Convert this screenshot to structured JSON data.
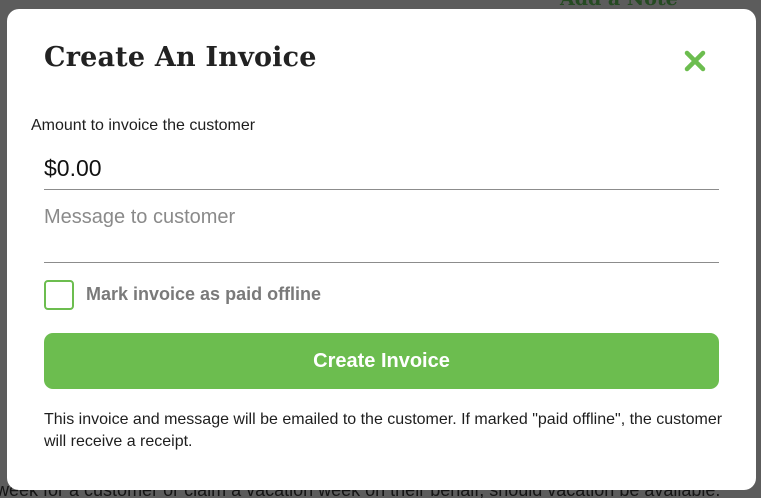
{
  "background": {
    "top_text": "Add a Note",
    "bottom_text": "week for a customer or claim a vacation week on their behalf, should vacation be available."
  },
  "modal": {
    "title": "Create An Invoice",
    "close_icon": "close-x-icon",
    "amount": {
      "label": "Amount to invoice the customer",
      "value": "$0.00"
    },
    "message": {
      "placeholder": "Message to customer",
      "value": ""
    },
    "paid_offline": {
      "label": "Mark invoice as paid offline",
      "checked": false
    },
    "submit_label": "Create Invoice",
    "footnote": "This invoice and message will be emailed to the customer. If marked \"paid offline\", the customer will receive a receipt."
  },
  "colors": {
    "accent": "#6cbd4f",
    "overlay": "#5c5c5c",
    "text": "#1e1e1e",
    "placeholder": "#8a8a8a"
  }
}
